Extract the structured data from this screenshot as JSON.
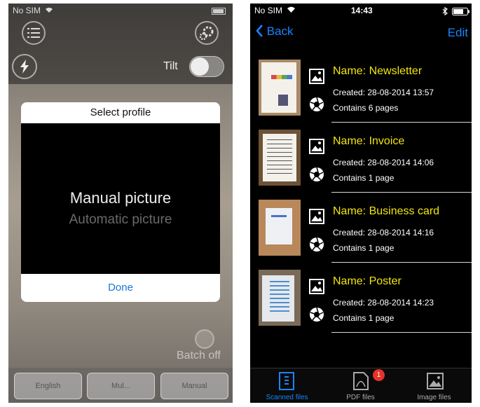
{
  "left_screen": {
    "status": {
      "carrier": "No SIM"
    },
    "tilt_label": "Tilt",
    "modal": {
      "title": "Select profile",
      "options": [
        "Manual picture",
        "Automatic picture"
      ],
      "done_label": "Done"
    },
    "batch_label": "Batch off",
    "bottom_buttons": [
      "English",
      "Mul...",
      "Manual"
    ]
  },
  "right_screen": {
    "status": {
      "carrier": "No SIM",
      "time": "14:43"
    },
    "nav": {
      "back_label": "Back",
      "edit_label": "Edit"
    },
    "files": [
      {
        "name": "Name: Newsletter",
        "created": "Created: 28-08-2014 13:57",
        "pages": "Contains 6 pages"
      },
      {
        "name": "Name: Invoice",
        "created": "Created: 28-08-2014 14:06",
        "pages": "Contains 1 page"
      },
      {
        "name": "Name: Business card",
        "created": "Created: 28-08-2014 14:16",
        "pages": "Contains 1 page"
      },
      {
        "name": "Name: Poster",
        "created": "Created: 28-08-2014 14:23",
        "pages": "Contains 1 page"
      }
    ],
    "tabs": [
      {
        "label": "Scanned files",
        "icon": "document-icon",
        "active": true
      },
      {
        "label": "PDF files",
        "icon": "pdf-icon",
        "badge": "1"
      },
      {
        "label": "Image files",
        "icon": "image-icon"
      }
    ]
  },
  "colors": {
    "accent": "#1a84ff",
    "file_name": "#f2e60e",
    "badge": "#e5322a"
  }
}
